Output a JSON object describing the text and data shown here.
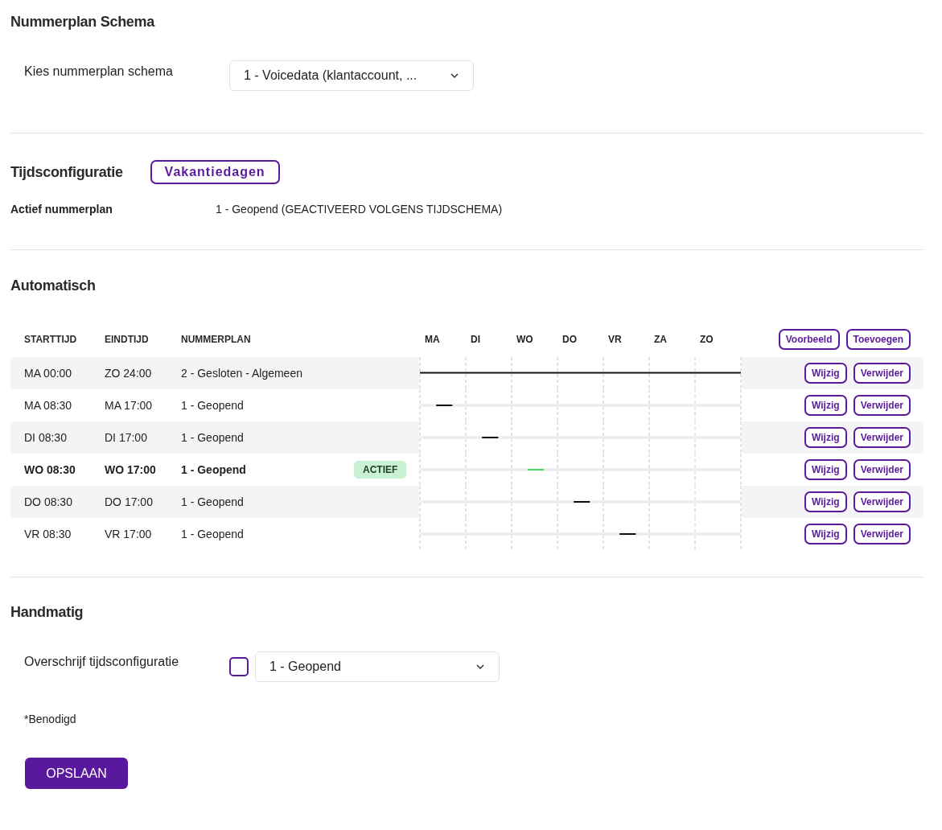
{
  "schema_section": {
    "title": "Nummerplan Schema",
    "label": "Kies nummerplan schema",
    "select_value": "1 - Voicedata (klantaccount, ..."
  },
  "time_config": {
    "title": "Tijdsconfiguratie",
    "holidays_button": "Vakantiedagen",
    "active_label": "Actief nummerplan",
    "active_value": "1 - Geopend (GEACTIVEERD VOLGENS TIJDSCHEMA)"
  },
  "automatic": {
    "title": "Automatisch",
    "columns": [
      "STARTTIJD",
      "EINDTIJD",
      "NUMMERPLAN"
    ],
    "days": [
      "MA",
      "DI",
      "WO",
      "DO",
      "VR",
      "ZA",
      "ZO"
    ],
    "buttons": [
      "Voorbeeld",
      "Toevoegen"
    ],
    "rows": [
      {
        "start": "MA 00:00",
        "end": "ZO 24:00",
        "plan": "2 - Gesloten - Algemeen",
        "active": false,
        "edit_button": "Wijzig",
        "delete_button": "Verwijder"
      },
      {
        "start": "MA 08:30",
        "end": "MA 17:00",
        "plan": "1 - Geopend",
        "active": false,
        "edit_button": "Wijzig",
        "delete_button": "Verwijder"
      },
      {
        "start": "DI 08:30",
        "end": "DI 17:00",
        "plan": "1 - Geopend",
        "active": false,
        "edit_button": "Wijzig",
        "delete_button": "Verwijder"
      },
      {
        "start": "WO 08:30",
        "end": "WO 17:00",
        "plan": "1 - Geopend",
        "active": true,
        "badge": "ACTIEF",
        "edit_button": "Wijzig",
        "delete_button": "Verwijder"
      },
      {
        "start": "DO 08:30",
        "end": "DO 17:00",
        "plan": "1 - Geopend",
        "active": false,
        "edit_button": "Wijzig",
        "delete_button": "Verwijder"
      },
      {
        "start": "VR 08:30",
        "end": "VR 17:00",
        "plan": "1 - Geopend",
        "active": false,
        "edit_button": "Wijzig",
        "delete_button": "Verwijder"
      }
    ]
  },
  "manual": {
    "title": "Handmatig",
    "label": "Overschrijf tijdsconfiguratie",
    "checked": false,
    "select_value": "1 - Geopend"
  },
  "required_note": "*Benodigd",
  "save_button": "OPSLAAN"
}
